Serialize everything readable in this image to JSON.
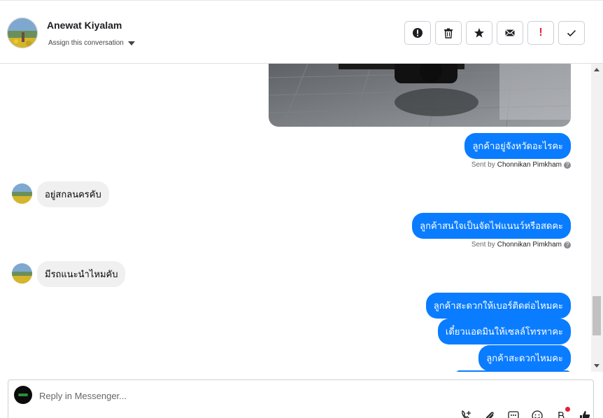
{
  "header": {
    "contact_name": "Anewat Kiyalam",
    "assign_label": "Assign this conversation"
  },
  "actions": [
    {
      "name": "spam-button",
      "icon": "alert-circle-icon"
    },
    {
      "name": "delete-button",
      "icon": "trash-icon"
    },
    {
      "name": "follow-up-button",
      "icon": "star-icon"
    },
    {
      "name": "mark-unread-button",
      "icon": "envelope-icon"
    },
    {
      "name": "priority-button",
      "icon": "exclamation-icon",
      "glyph": "!"
    },
    {
      "name": "mark-done-button",
      "icon": "check-icon"
    }
  ],
  "thread": {
    "messages": [
      {
        "direction": "out",
        "text": "ลูกค้าอยู่จังหวัดอะไรคะ"
      },
      {
        "type": "sent_by",
        "prefix": "Sent by",
        "author": "Chonnikan Pimkham"
      },
      {
        "direction": "in",
        "text": "อยู่สกลนครคับ"
      },
      {
        "direction": "out",
        "text": "ลูกค้าสนใจเป็นจัดไฟแนนว์หรือสดคะ"
      },
      {
        "type": "sent_by",
        "prefix": "Sent by",
        "author": "Chonnikan Pimkham"
      },
      {
        "direction": "in",
        "text": "มีรถแนะนำไหมคับ"
      },
      {
        "direction": "out",
        "text": "ลูกค้าสะดวกให้เบอร์ติดต่อไหมคะ"
      },
      {
        "direction": "out",
        "text": "เดี๋ยวแอดมินให้เซลล์โทรหาคะ"
      },
      {
        "direction": "out",
        "text": "ลูกค้าสะดวกไหมคะ"
      }
    ]
  },
  "composer": {
    "placeholder": "Reply in Messenger..."
  },
  "tools": [
    {
      "name": "add-contact-icon"
    },
    {
      "name": "attachment-icon"
    },
    {
      "name": "saved-replies-icon"
    },
    {
      "name": "emoji-icon"
    },
    {
      "name": "payment-icon",
      "has_badge": true
    },
    {
      "name": "like-icon"
    }
  ],
  "colors": {
    "outgoing_bubble": "#0a7cff",
    "incoming_bubble": "#f0f0f0",
    "priority": "#e41e3f"
  }
}
